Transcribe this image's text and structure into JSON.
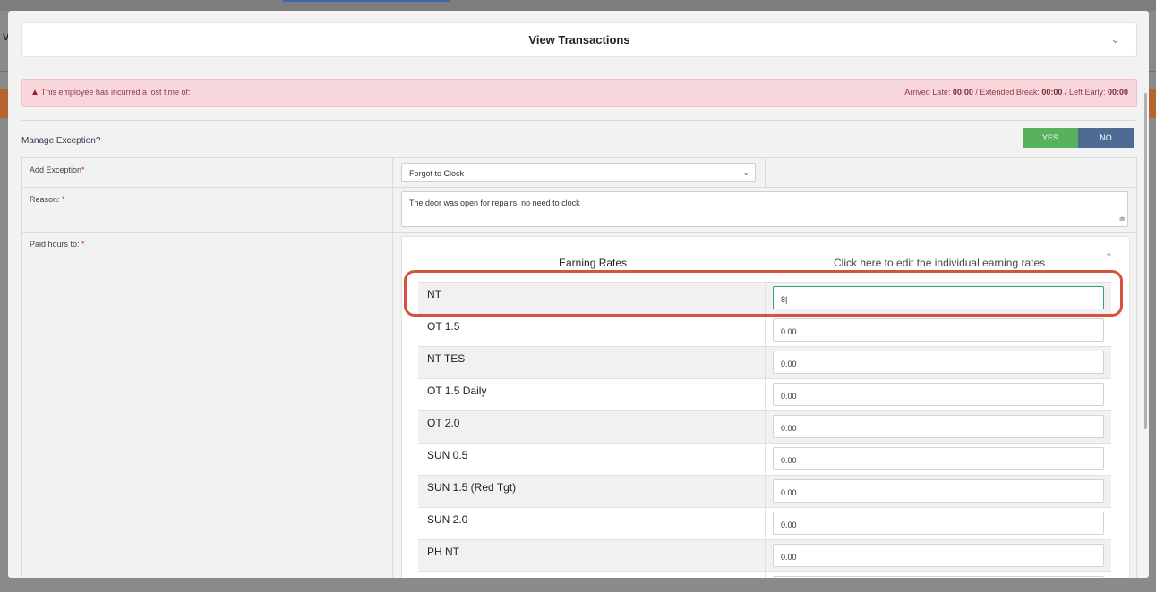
{
  "background": {
    "left_letter": "V"
  },
  "panel": {
    "title": "View Transactions"
  },
  "alert": {
    "message": "This employee has incurred a lost time of:",
    "arrived_late_label": "Arrived Late: ",
    "arrived_late_value": "00:00",
    "extended_break_label": " / Extended Break: ",
    "extended_break_value": "00:00",
    "left_early_label": " / Left Early: ",
    "left_early_value": "00:00"
  },
  "manage": {
    "label": "Manage Exception?",
    "yes_label": "YES",
    "no_label": "NO",
    "selected": "YES"
  },
  "form": {
    "add_exception_label": "Add Exception",
    "add_exception_value": "Forgot to Clock",
    "reason_label": "Reason: ",
    "reason_value": "The door was open for repairs, no need to clock",
    "paid_hours_label": "Paid hours to: ",
    "required_mark": "*"
  },
  "earning_rates": {
    "title": "Earning Rates",
    "edit_link": "Click here to edit the individual earning rates",
    "rows": [
      {
        "name": "NT",
        "value": "8"
      },
      {
        "name": "OT 1.5",
        "value": "0.00"
      },
      {
        "name": "NT TES",
        "value": "0.00"
      },
      {
        "name": "OT 1.5 Daily",
        "value": "0.00"
      },
      {
        "name": "OT 2.0",
        "value": "0.00"
      },
      {
        "name": "SUN 0.5",
        "value": "0.00"
      },
      {
        "name": "SUN 1.5 (Red Tgt)",
        "value": "0.00"
      },
      {
        "name": "SUN 2.0",
        "value": "0.00"
      },
      {
        "name": "PH NT",
        "value": "0.00"
      },
      {
        "name": "",
        "value": ""
      }
    ]
  },
  "colors": {
    "yes_active": "#58b15d",
    "no": "#4e6b94",
    "highlight": "#d5533d",
    "focus": "#2ba37f"
  }
}
